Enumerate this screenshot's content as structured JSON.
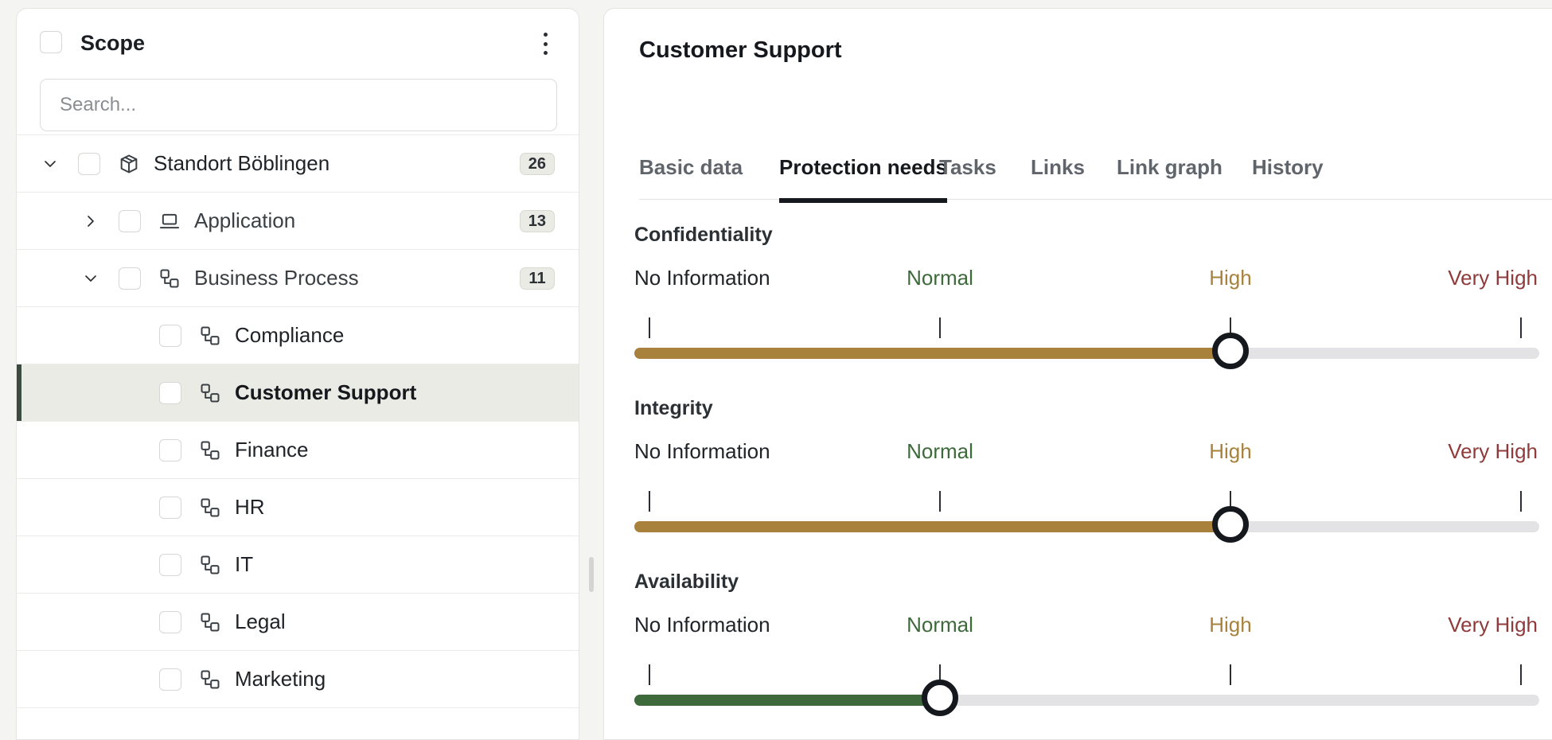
{
  "sidebar": {
    "title": "Scope",
    "search_placeholder": "Search...",
    "items": [
      {
        "label": "Standort Böblingen",
        "count": "26",
        "level": 0,
        "expanded": true,
        "icon": "box-icon",
        "selected": false
      },
      {
        "label": "Application",
        "count": "13",
        "level": 1,
        "expanded": false,
        "icon": "laptop-icon",
        "selected": false
      },
      {
        "label": "Business Process",
        "count": "11",
        "level": 1,
        "expanded": true,
        "icon": "process-icon",
        "selected": false
      },
      {
        "label": "Compliance",
        "level": 2,
        "icon": "process-icon",
        "selected": false
      },
      {
        "label": "Customer Support",
        "level": 2,
        "icon": "process-icon",
        "selected": true
      },
      {
        "label": "Finance",
        "level": 2,
        "icon": "process-icon",
        "selected": false
      },
      {
        "label": "HR",
        "level": 2,
        "icon": "process-icon",
        "selected": false
      },
      {
        "label": "IT",
        "level": 2,
        "icon": "process-icon",
        "selected": false
      },
      {
        "label": "Legal",
        "level": 2,
        "icon": "process-icon",
        "selected": false
      },
      {
        "label": "Marketing",
        "level": 2,
        "icon": "process-icon",
        "selected": false
      }
    ]
  },
  "main": {
    "title": "Customer Support",
    "tabs": [
      {
        "label": "Basic data",
        "active": false
      },
      {
        "label": "Protection needs",
        "active": true
      },
      {
        "label": "Tasks",
        "active": false
      },
      {
        "label": "Links",
        "active": false
      },
      {
        "label": "Link graph",
        "active": false
      },
      {
        "label": "History",
        "active": false
      }
    ],
    "levels": [
      {
        "label": "No Information",
        "color": "#1f2328"
      },
      {
        "label": "Normal",
        "color": "#3e6a3b"
      },
      {
        "label": "High",
        "color": "#a8823c"
      },
      {
        "label": "Very High",
        "color": "#8f3b3b"
      }
    ],
    "sections": [
      {
        "title": "Confidentiality",
        "value_index": 2,
        "fill_color": "#a8823c"
      },
      {
        "title": "Integrity",
        "value_index": 2,
        "fill_color": "#a8823c"
      },
      {
        "title": "Availability",
        "value_index": 1,
        "fill_color": "#3e6a3b"
      }
    ]
  }
}
